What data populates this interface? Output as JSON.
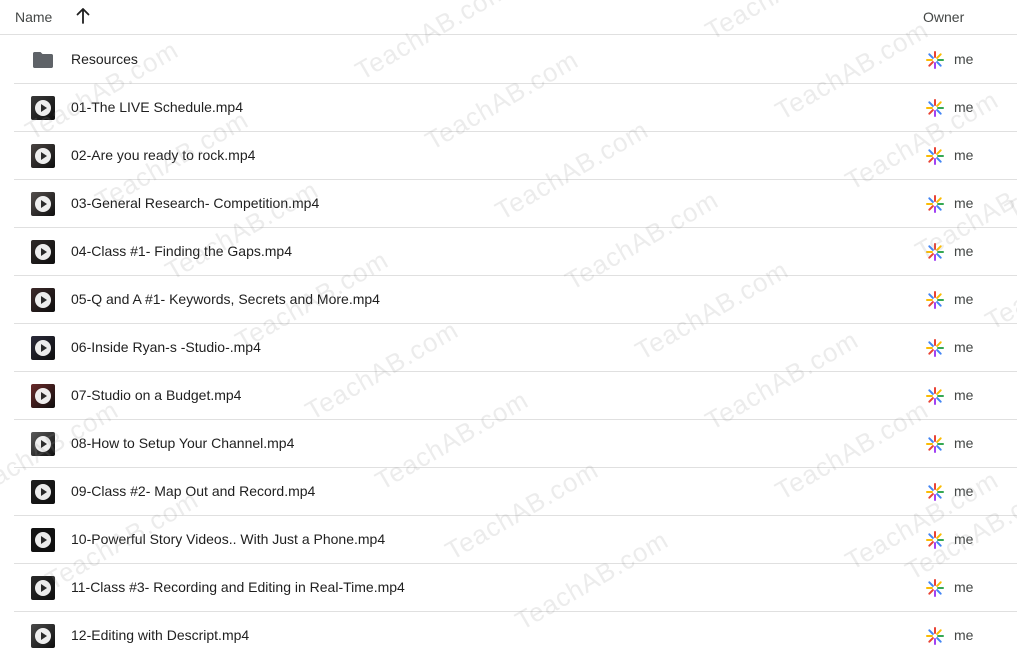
{
  "header": {
    "name_label": "Name",
    "owner_label": "Owner",
    "sort_direction": "ascending"
  },
  "colors": {
    "folder": "#5f6368",
    "divider": "#e0e0e0",
    "text": "#1f1f1f",
    "muted": "#444746"
  },
  "watermark": "TeachAB.com",
  "files": [
    {
      "name": "Resources",
      "type": "folder",
      "icon": "folder-icon",
      "owner": "me"
    },
    {
      "name": "01-The LIVE Schedule.mp4",
      "type": "video",
      "icon": "video-thumbnail-icon",
      "owner": "me",
      "thumb": "#3a3a3a"
    },
    {
      "name": "02-Are you ready to rock.mp4",
      "type": "video",
      "icon": "video-thumbnail-icon",
      "owner": "me",
      "thumb": "#4a4442"
    },
    {
      "name": "03-General Research- Competition.mp4",
      "type": "video",
      "icon": "video-thumbnail-icon",
      "owner": "me",
      "thumb": "#55504e"
    },
    {
      "name": "04-Class #1- Finding the Gaps.mp4",
      "type": "video",
      "icon": "video-thumbnail-icon",
      "owner": "me",
      "thumb": "#2f2a28"
    },
    {
      "name": "05-Q and A #1- Keywords, Secrets and More.mp4",
      "type": "video",
      "icon": "video-thumbnail-icon",
      "owner": "me",
      "thumb": "#3d2a2a"
    },
    {
      "name": "06-Inside Ryan-s -Studio-.mp4",
      "type": "video",
      "icon": "video-thumbnail-icon",
      "owner": "me",
      "thumb": "#2a2a3a"
    },
    {
      "name": "07-Studio on a Budget.mp4",
      "type": "video",
      "icon": "video-thumbnail-icon",
      "owner": "me",
      "thumb": "#6a2a2a"
    },
    {
      "name": "08-How to Setup Your Channel.mp4",
      "type": "video",
      "icon": "video-thumbnail-icon",
      "owner": "me",
      "thumb": "#5a5a5a"
    },
    {
      "name": "09-Class #2- Map Out and Record.mp4",
      "type": "video",
      "icon": "video-thumbnail-icon",
      "owner": "me",
      "thumb": "#1f1f1f"
    },
    {
      "name": "10-Powerful Story Videos.. With Just a Phone.mp4",
      "type": "video",
      "icon": "video-thumbnail-icon",
      "owner": "me",
      "thumb": "#151515"
    },
    {
      "name": "11-Class #3- Recording and Editing in Real-Time.mp4",
      "type": "video",
      "icon": "video-thumbnail-icon",
      "owner": "me",
      "thumb": "#2a2a2a"
    },
    {
      "name": "12-Editing with Descript.mp4",
      "type": "video",
      "icon": "video-thumbnail-icon",
      "owner": "me",
      "thumb": "#4a4a4a"
    }
  ]
}
